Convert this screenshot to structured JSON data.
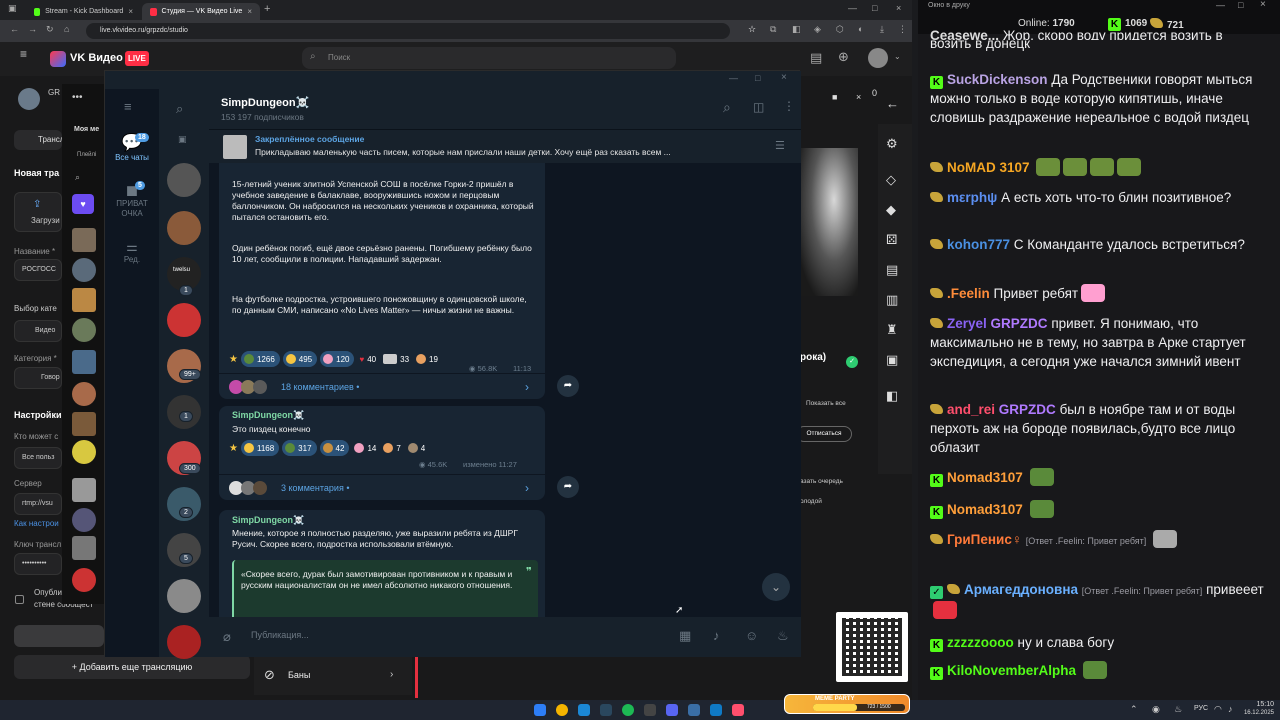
{
  "browser": {
    "tabs": [
      {
        "label": "Stream - Kick Dashboard",
        "active": false
      },
      {
        "label": "Студия — VK Видео Live",
        "active": true
      }
    ],
    "url": "live.vkvideo.ru/grpzdc/studio"
  },
  "vk": {
    "brand": "VK Видео",
    "live_badge": "LIVE",
    "search_placeholder": "Поиск",
    "sidebar": {
      "channel_short": "GR",
      "broadcast_tab": "Трансл",
      "new_broadcast": "Новая тра",
      "upload_label": "Загрузи",
      "name_label": "Название *",
      "name_value": "РОСГОСС",
      "category_section": "Выбор кате",
      "category_option": "Видео",
      "category_label": "Категория *",
      "category_value": "Говор",
      "settings_title": "Настройки",
      "who_can_label": "Кто может с",
      "who_can_value": "Все польз",
      "server_label": "Сервер",
      "server_value": "rtmp://vsu",
      "how_setup_link": "Как настрои",
      "key_label": "Ключ трансл",
      "key_value": "••••••••••",
      "publish_checkbox": "Опублик",
      "publish_checkbox2": "стене сообщест",
      "add_broadcast": "Добавить еще трансляцию",
      "bans": "Баны"
    },
    "mini_panel": {
      "my_label": "Моя ме",
      "playlist_label": "Плейлі"
    },
    "right_panel": {
      "preview_label": "рока)",
      "show_all": "Показать все",
      "unsubscribe": "Отписаться",
      "queue_text": "азать очередь",
      "young_text": "олодой",
      "counter": "0"
    }
  },
  "telegram": {
    "window_title": "",
    "folders": [
      {
        "label": "Все чаты",
        "badge": "18",
        "selected": true
      },
      {
        "label": "ПРИВАТ ОЧКА",
        "badge": "5",
        "selected": false
      },
      {
        "label": "Ред.",
        "badge": "",
        "selected": false
      }
    ],
    "chat_badges": [
      "1",
      "99+",
      "1",
      "300",
      "2",
      "5"
    ],
    "chat_title_small": "twelsu",
    "channel": {
      "name": "SimpDungeon☠️",
      "subscribers": "153 197 подписчиков"
    },
    "pinned": {
      "title": "Закреплённое сообщение",
      "text": "Прикладываю маленькую часть писем, которые нам прислали наши детки.  Хочу ещё раз сказать всем ..."
    },
    "messages": [
      {
        "paragraphs": [
          "15-летний ученик элитной Успенской СОШ в посёлке Горки-2 пришёл в учебное заведение в балаклаве, вооружившись ножом и перцовым баллончиком. Он набросился на нескольких учеников и охранника, который пытался остановить его.",
          "Один ребёнок погиб, ещё двое серьёзно ранены. Погибшему ребёнку было 10 лет, сообщили в полиции. Нападавший задержан.",
          "На футболке подростка, устроившего поножовщину в одинцовской школе, по данным СМИ, написано «No Lives Matter» — ничьи жизни не важны."
        ],
        "reactions": [
          "1266",
          "495",
          "120",
          "40",
          "33",
          "19"
        ],
        "views": "56.8K",
        "time": "11:13",
        "comments": "18 комментариев"
      },
      {
        "author": "SimpDungeon☠️",
        "text": "Это пиздец конечно",
        "reactions": [
          "1168",
          "317",
          "42",
          "14",
          "7",
          "4"
        ],
        "views": "45.6K",
        "time": "изменено 11:27",
        "comments": "3 комментария"
      },
      {
        "author": "SimpDungeon☠️",
        "text": "Мнение, которое я полностью разделяю, уже выразили ребята из ДШРГ Русич. Скорее всего, подростка использовали втёмную.",
        "quote": "«Скорее всего, дурак был замотивирован противником и к правым и русским националистам он не имел абсолютно никакого отношения."
      }
    ],
    "input_placeholder": "Публикация..."
  },
  "chat_panel": {
    "window_title": "Окно в друку",
    "online_label": "Online:",
    "online_count": "1790",
    "kick_count": "1069",
    "vk_count": "721",
    "messages": [
      {
        "badge": "kick",
        "user": "SuckDickenson",
        "color": "#b9a3e3",
        "text": "Да Родственики говорят мыться можно только в воде которую кипятишь, иначе словишь раздражение нереальное с водой пиздец"
      },
      {
        "badge": "vk",
        "user": "NoMAD 3107",
        "color": "#f5a623",
        "text": ""
      },
      {
        "badge": "vk",
        "user": "mεrphψ",
        "color": "#5b8ef0",
        "text": "А есть хоть что-то блин позитивное?"
      },
      {
        "badge": "vk",
        "user": "kohon777",
        "color": "#4a90e2",
        "text": "С Команданте удалось встретиться?"
      },
      {
        "badge": "vk",
        "user": ".Feelin",
        "color": "#ff8c3a",
        "text": "Привет ребят"
      },
      {
        "badge": "vk",
        "user": "Zeryel",
        "color": "#8a63f5",
        "mention": "GRPZDC",
        "text": "привет. Я понимаю, что максимально не в тему, но завтра в Арке стартует экспедиция, а сегодня уже начался зимний ивент"
      },
      {
        "badge": "vk",
        "user": "and_rei",
        "color": "#ff4f6d",
        "mention": "GRPZDC",
        "text": "был в ноябре там и от воды перхоть аж на бороде появилась,будто все лицо облазит"
      },
      {
        "badge": "kick",
        "user": "Nomad3107",
        "color": "#ff9f3a",
        "text": ""
      },
      {
        "badge": "kick",
        "user": "Nomad3107",
        "color": "#ff9f3a",
        "text": ""
      },
      {
        "badge": "vk",
        "user": "ГриПенис♀",
        "color": "#ff7a3a",
        "reply": "[Ответ .Feelin: Привет ребят]",
        "text": ""
      },
      {
        "badge": "vk2",
        "user": "Армагеддоновна",
        "color": "#6ab0ff",
        "reply": "[Ответ .Feelin: Привет ребят]",
        "text": "привееет"
      },
      {
        "badge": "kick",
        "user": "zzzzzoooo",
        "color": "#53fc18",
        "text": "ну и слава богу"
      },
      {
        "badge": "kick",
        "user": "KiloNovemberAlpha",
        "color": "#53fc18",
        "text": ""
      }
    ],
    "partial_top": {
      "user": "Ceasewe...",
      "text": "Жор, скоро воду придется возить в донецк"
    }
  },
  "taskbar": {
    "lang": "РУС",
    "time": "15:10",
    "date": "16.12.2025",
    "overlay_title": "MEME PARTY",
    "overlay_progress": "723 / 1500"
  }
}
